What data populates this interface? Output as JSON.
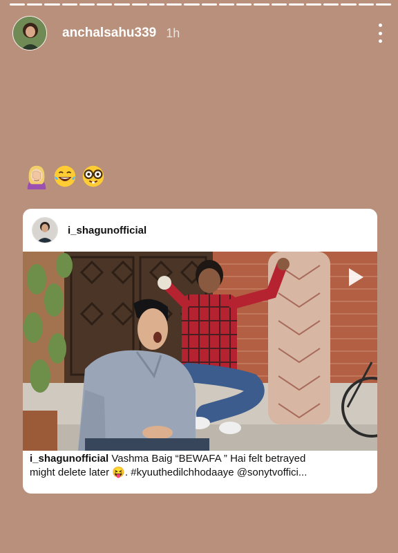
{
  "story": {
    "username": "anchalsahu339",
    "time": "1h",
    "progress_segments": 22,
    "progress_done": 22
  },
  "emojis": [
    "woman-facepalming-icon",
    "tears-of-joy-icon",
    "nerd-face-icon"
  ],
  "post": {
    "username": "i_shagunofficial",
    "caption_user": "i_shagunofficial",
    "caption_line1": " Vashma Baig “BEWAFA ” Hai  felt betrayed",
    "caption_line2a": "might delete later ",
    "caption_emoji": "😝",
    "caption_line2b": ". #kyuuthedilchhodaaye @sonytvoffici..."
  },
  "colors": {
    "background": "#b8907b",
    "card": "#ffffff"
  }
}
